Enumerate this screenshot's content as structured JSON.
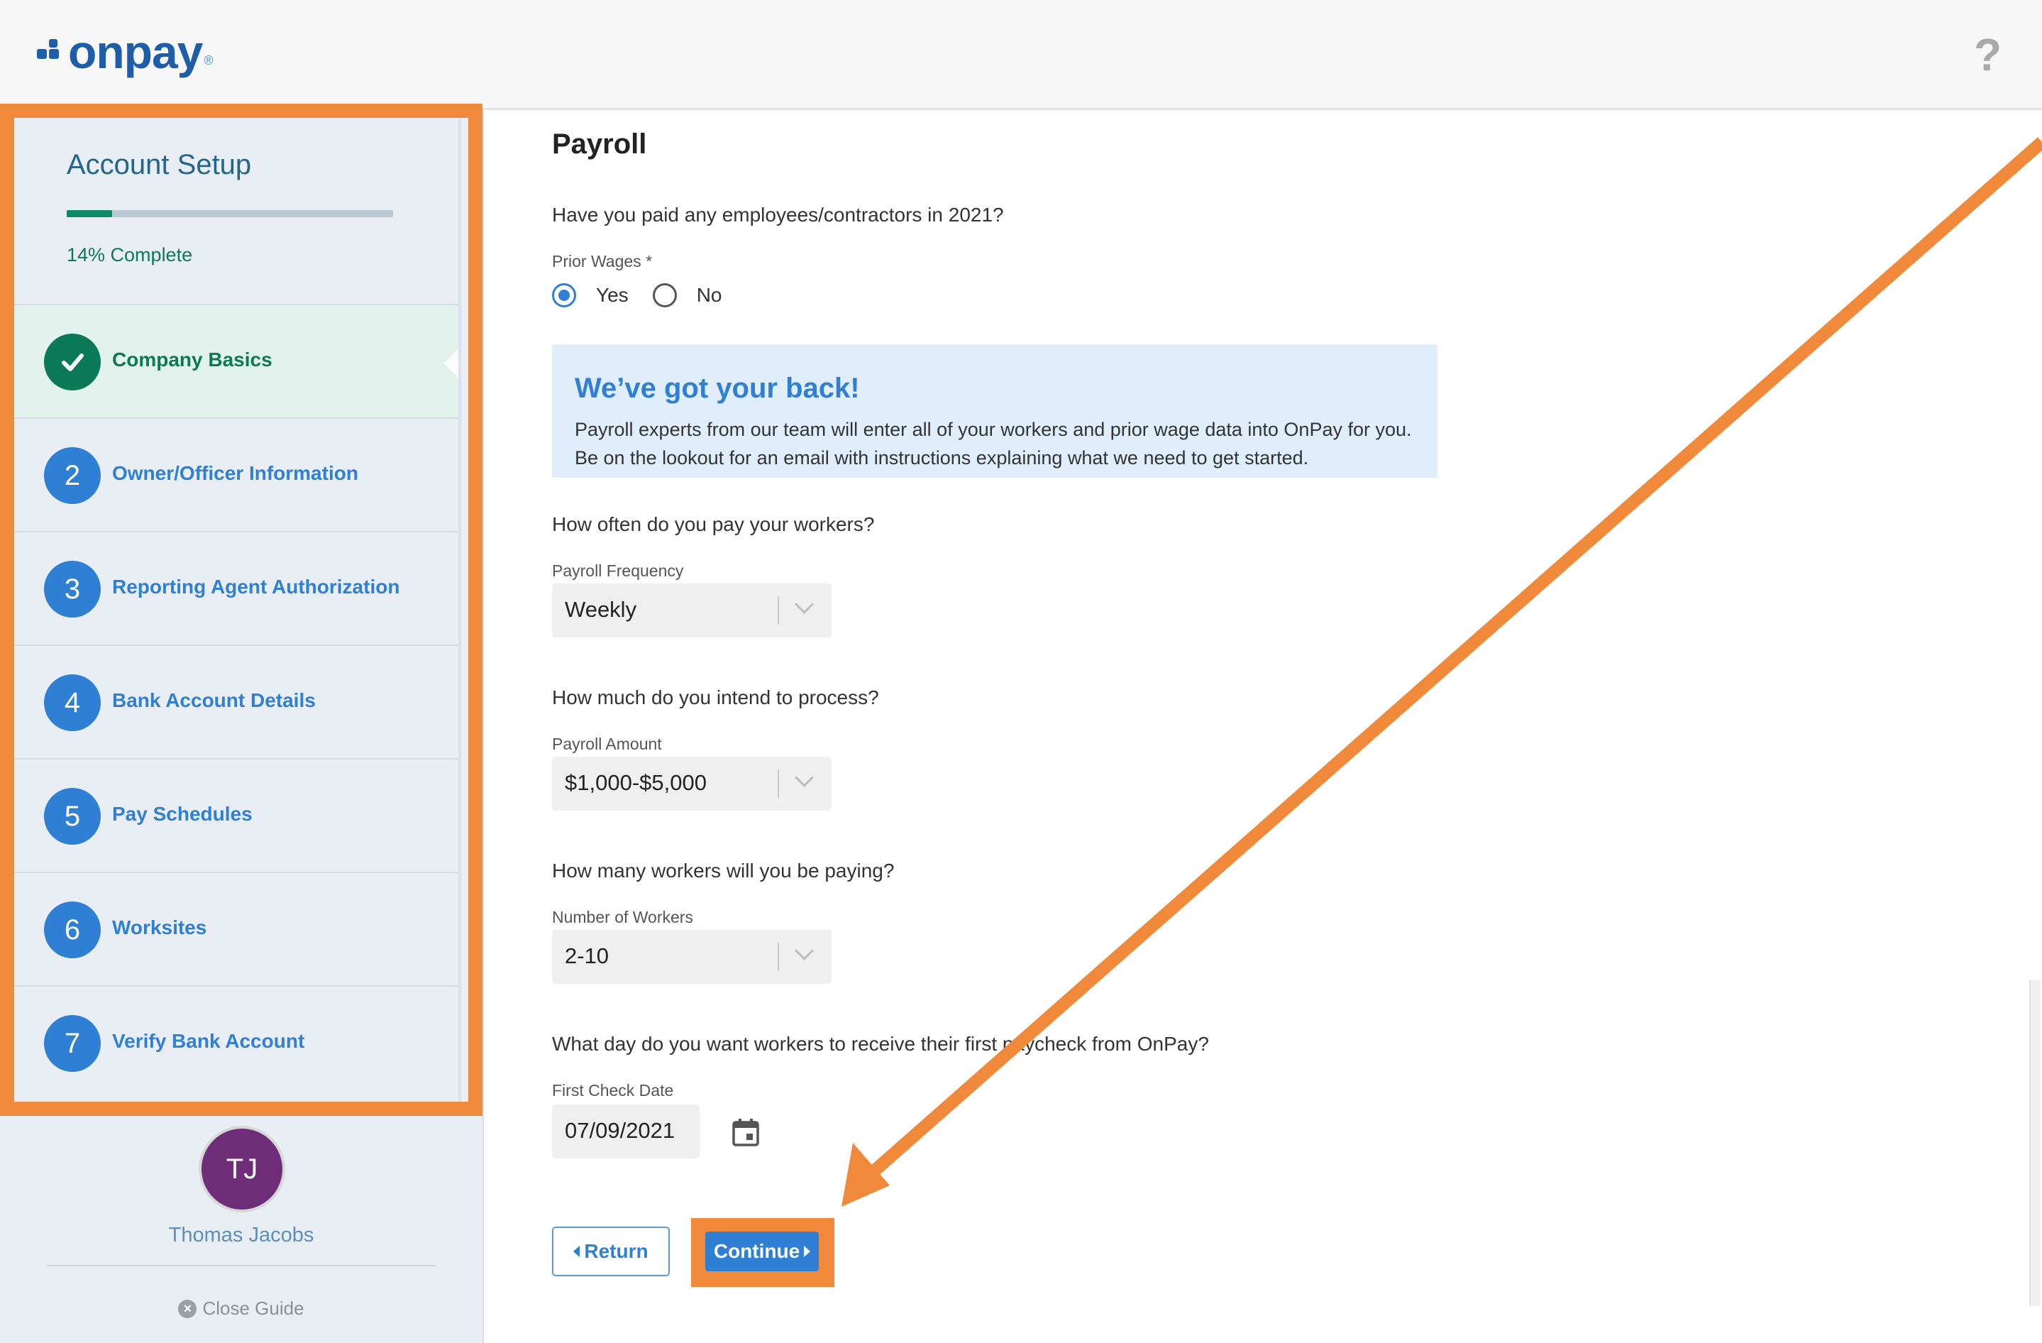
{
  "header": {
    "logo_text": "onpay",
    "logo_mark": "®",
    "help_label": "?"
  },
  "sidebar": {
    "title": "Account Setup",
    "progress_percent": 14,
    "progress_text": "14% Complete",
    "steps": [
      {
        "number": "",
        "label": "Company Basics",
        "status": "complete"
      },
      {
        "number": "2",
        "label": "Owner/Officer Information",
        "status": "pending"
      },
      {
        "number": "3",
        "label": "Reporting Agent Authorization",
        "status": "pending"
      },
      {
        "number": "4",
        "label": "Bank Account Details",
        "status": "pending"
      },
      {
        "number": "5",
        "label": "Pay Schedules",
        "status": "pending"
      },
      {
        "number": "6",
        "label": "Worksites",
        "status": "pending"
      },
      {
        "number": "7",
        "label": "Verify Bank Account",
        "status": "pending"
      }
    ],
    "user": {
      "initials": "TJ",
      "name": "Thomas Jacobs"
    },
    "close_guide": "Close Guide"
  },
  "main": {
    "title": "Payroll",
    "prior_wages": {
      "question": "Have you paid any employees/contractors in 2021?",
      "label": "Prior Wages *",
      "options": [
        "Yes",
        "No"
      ],
      "selected": "Yes"
    },
    "info": {
      "title": "We’ve got your back!",
      "text": "Payroll experts from our team will enter all of your workers and prior wage data into OnPay for you. Be on the lookout for an email with instructions explaining what we need to get started."
    },
    "frequency": {
      "question": "How often do you pay your workers?",
      "label": "Payroll Frequency",
      "value": "Weekly"
    },
    "amount": {
      "question": "How much do you intend to process?",
      "label": "Payroll Amount",
      "value": "$1,000-$5,000"
    },
    "workers": {
      "question": "How many workers will you be paying?",
      "label": "Number of Workers",
      "value": "2-10"
    },
    "first_check": {
      "question": "What day do you want workers to receive their first paycheck from OnPay?",
      "label": "First Check Date",
      "value": "07/09/2021"
    },
    "buttons": {
      "return": "Return",
      "continue": "Continue"
    }
  },
  "colors": {
    "brand": "#1e5ea8",
    "accent": "#2f7fd4",
    "complete": "#0c7a57",
    "highlight": "#f08a3a",
    "avatar": "#6f2c79"
  }
}
